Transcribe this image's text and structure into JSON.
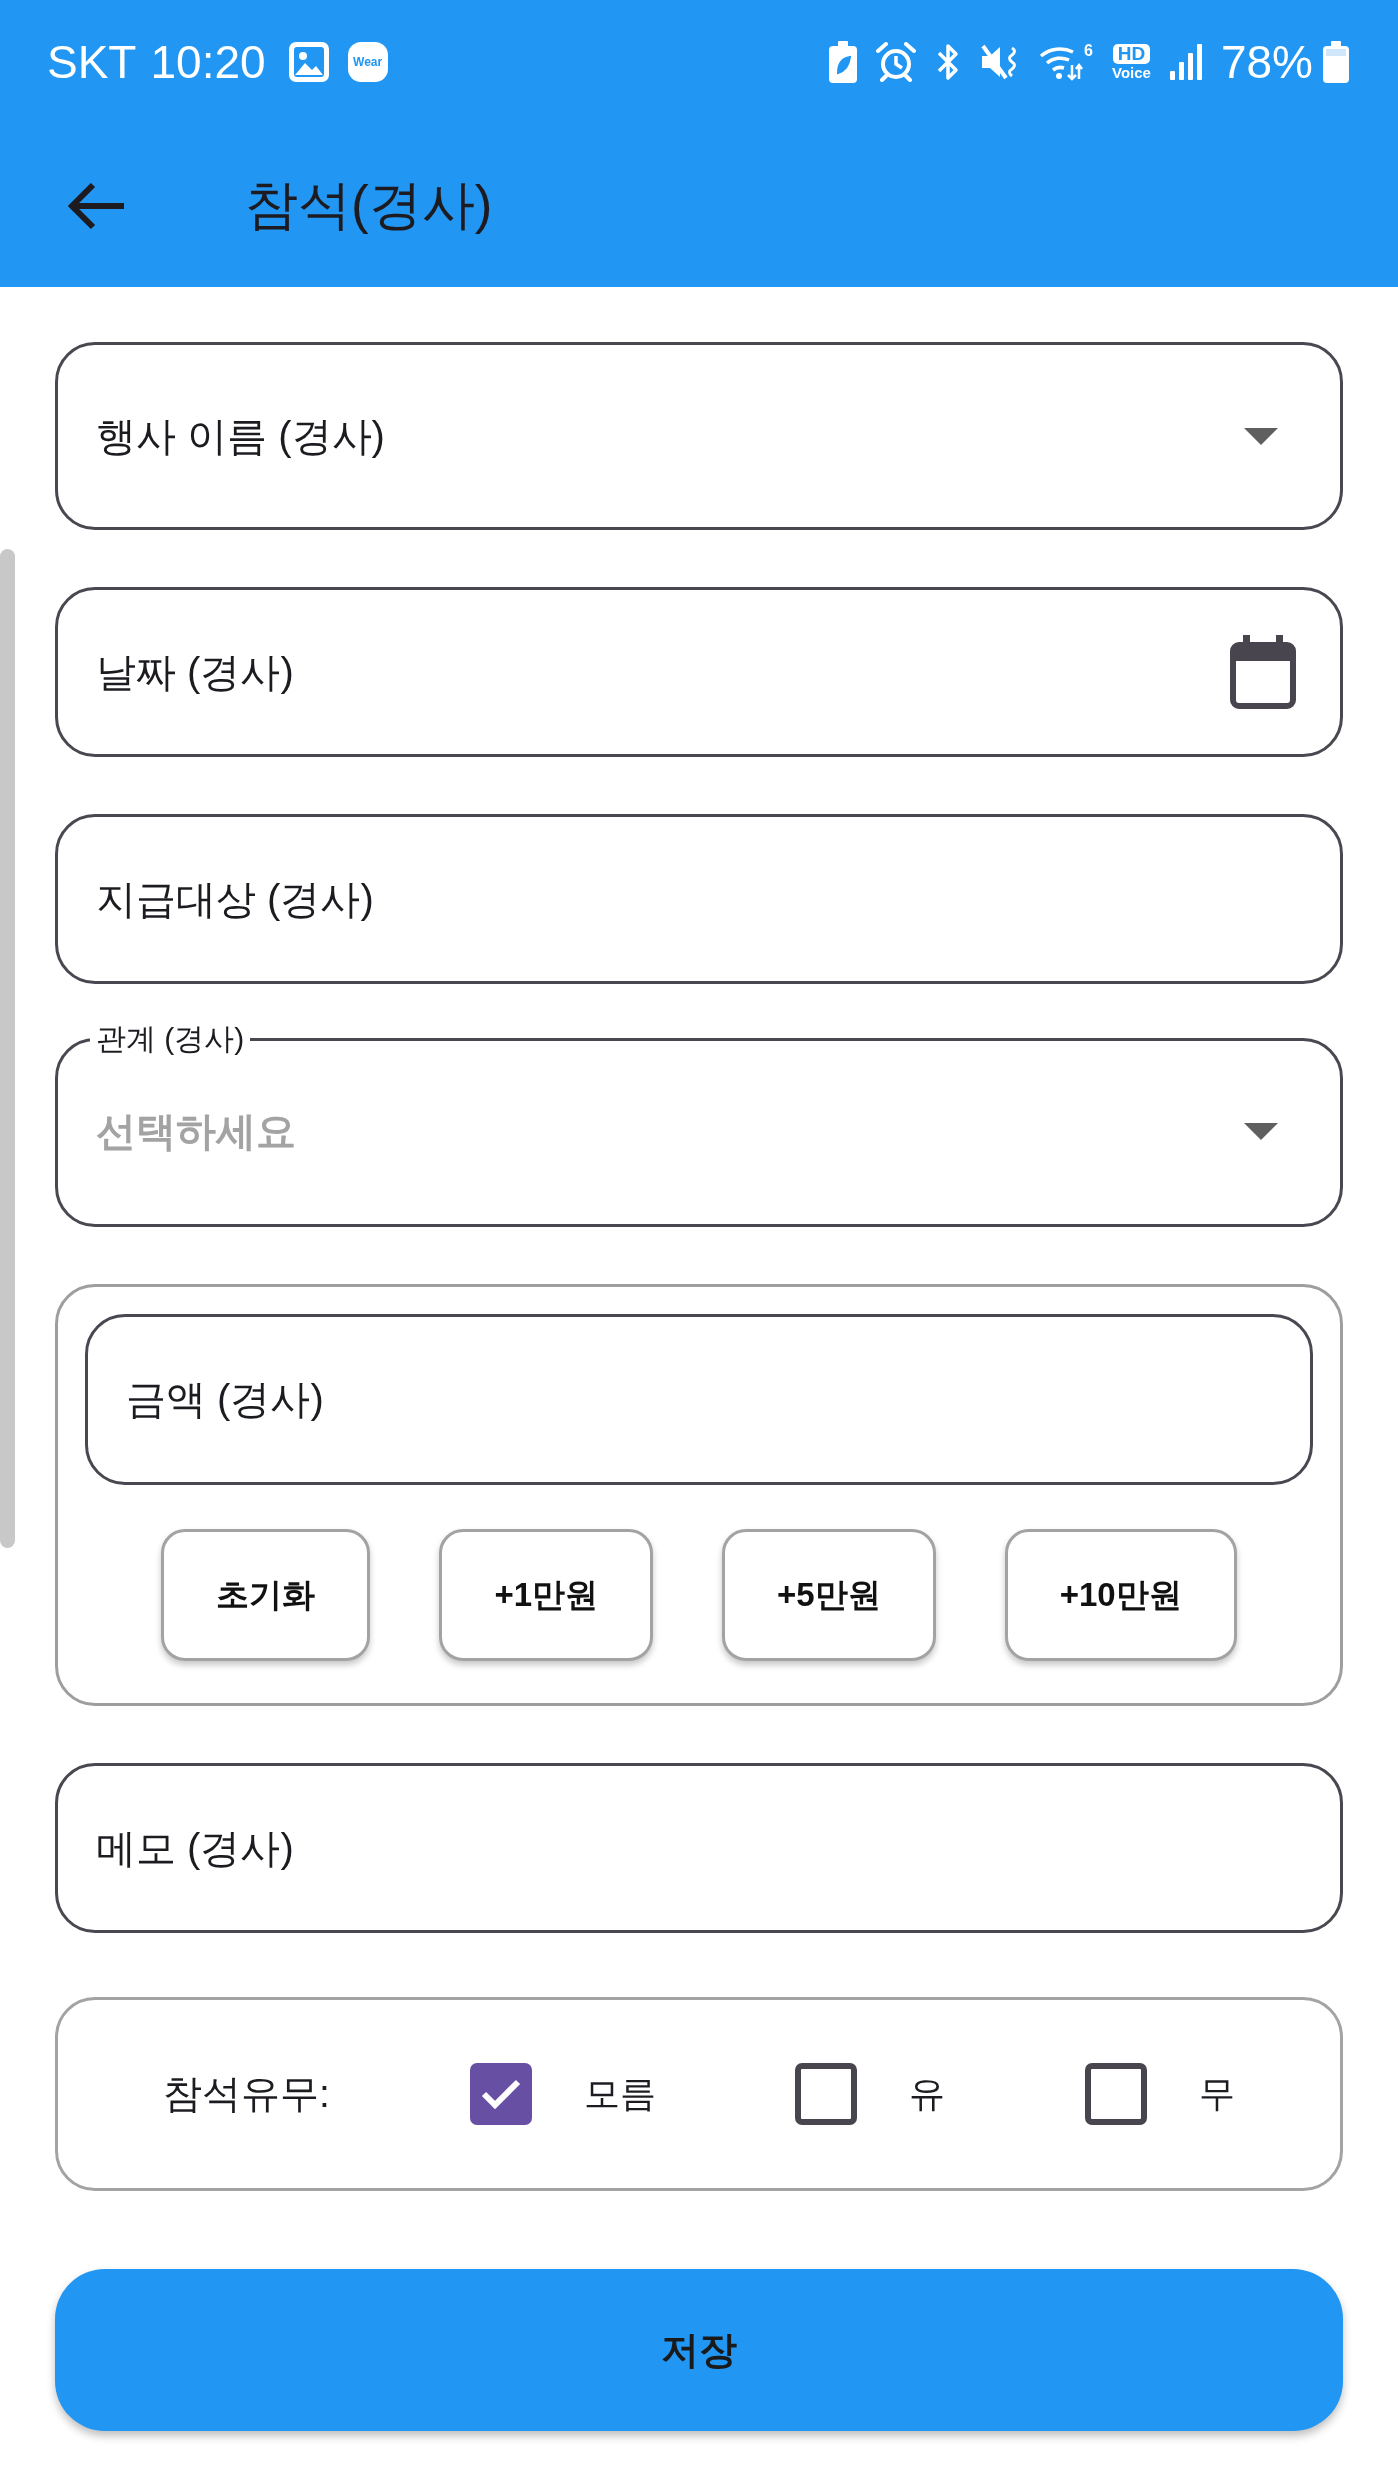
{
  "status_bar": {
    "carrier": "SKT",
    "time": "10:20",
    "notification_badge": "Wear",
    "wifi_standard": "6",
    "hd_voice": [
      "HD",
      "Voice"
    ],
    "battery_percent": "78%"
  },
  "app_bar": {
    "title": "참석(경사)"
  },
  "form": {
    "fields": [
      {
        "kind": "dropdown",
        "label": "행사 이름 (경사)"
      },
      {
        "kind": "date",
        "label": "날짜 (경사)"
      },
      {
        "kind": "text",
        "label": "지급대상 (경사)"
      },
      {
        "kind": "dropdown",
        "label": "관계 (경사)",
        "placeholder": "선택하세요"
      }
    ],
    "amount": {
      "field": {
        "kind": "text",
        "label": "금액 (경사)"
      },
      "buttons": [
        "초기화",
        "+1만원",
        "+5만원",
        "+10만원"
      ]
    },
    "memo": {
      "kind": "text",
      "label": "메모 (경사)"
    },
    "attendance": {
      "label": "참석유무:",
      "options": [
        {
          "label": "모름",
          "checked": true
        },
        {
          "label": "유",
          "checked": false
        },
        {
          "label": "무",
          "checked": false
        }
      ]
    },
    "save_button": "저장"
  }
}
